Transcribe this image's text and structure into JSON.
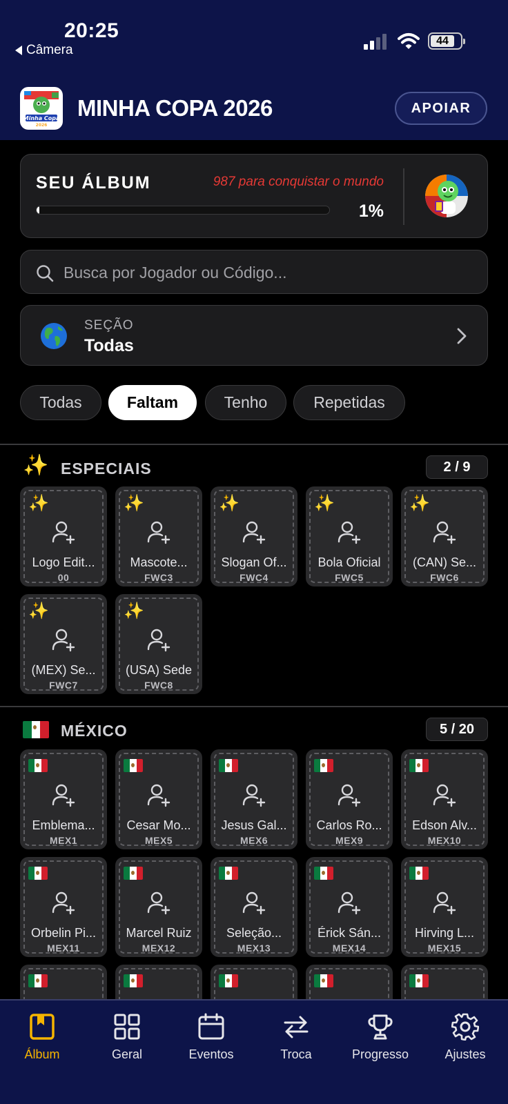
{
  "status": {
    "time": "20:25",
    "back_label": "Câmera",
    "battery": "44"
  },
  "header": {
    "title": "MINHA COPA 2026",
    "support_label": "APOIAR",
    "logo_text": "Minha Copa 2026"
  },
  "album": {
    "label": "SEU ÁLBUM",
    "remaining_text": "987 para conquistar o mundo",
    "percent_label": "1%",
    "progress": 0.01
  },
  "search": {
    "placeholder": "Busca por Jogador ou Código..."
  },
  "section": {
    "label": "SEÇÃO",
    "value": "Todas"
  },
  "filters": [
    {
      "label": "Todas",
      "active": false
    },
    {
      "label": "Faltam",
      "active": true
    },
    {
      "label": "Tenho",
      "active": false
    },
    {
      "label": "Repetidas",
      "active": false
    }
  ],
  "groups": [
    {
      "title": "ESPECIAIS",
      "icon": "sparkles-icon",
      "count": "2 / 9",
      "stickers": [
        {
          "name": "Logo Edit...",
          "code": "00"
        },
        {
          "name": "Mascote...",
          "code": "FWC3"
        },
        {
          "name": "Slogan Of...",
          "code": "FWC4"
        },
        {
          "name": "Bola Oficial",
          "code": "FWC5"
        },
        {
          "name": "(CAN) Se...",
          "code": "FWC6"
        },
        {
          "name": "(MEX) Se...",
          "code": "FWC7"
        },
        {
          "name": "(USA) Sede",
          "code": "FWC8"
        }
      ]
    },
    {
      "title": "MÉXICO",
      "icon": "mexico-flag-icon",
      "count": "5 / 20",
      "stickers": [
        {
          "name": "Emblema...",
          "code": "MEX1"
        },
        {
          "name": "Cesar Mo...",
          "code": "MEX5"
        },
        {
          "name": "Jesus Gal...",
          "code": "MEX6"
        },
        {
          "name": "Carlos Ro...",
          "code": "MEX9"
        },
        {
          "name": "Edson Alv...",
          "code": "MEX10"
        },
        {
          "name": "Orbelin Pi...",
          "code": "MEX11"
        },
        {
          "name": "Marcel Ruiz",
          "code": "MEX12"
        },
        {
          "name": "Seleção...",
          "code": "MEX13"
        },
        {
          "name": "Érick Sán...",
          "code": "MEX14"
        },
        {
          "name": "Hirving L...",
          "code": "MEX15"
        }
      ]
    }
  ],
  "nav": [
    {
      "label": "Álbum",
      "icon": "album-icon",
      "active": true
    },
    {
      "label": "Geral",
      "icon": "grid-icon",
      "active": false
    },
    {
      "label": "Eventos",
      "icon": "calendar-icon",
      "active": false
    },
    {
      "label": "Troca",
      "icon": "swap-icon",
      "active": false
    },
    {
      "label": "Progresso",
      "icon": "trophy-icon",
      "active": false
    },
    {
      "label": "Ajustes",
      "icon": "gear-icon",
      "active": false
    }
  ],
  "colors": {
    "header_bg": "#0d1449",
    "remaining_text": "#e53935",
    "nav_active": "#f5b400",
    "card_bg": "#1c1c1e"
  }
}
